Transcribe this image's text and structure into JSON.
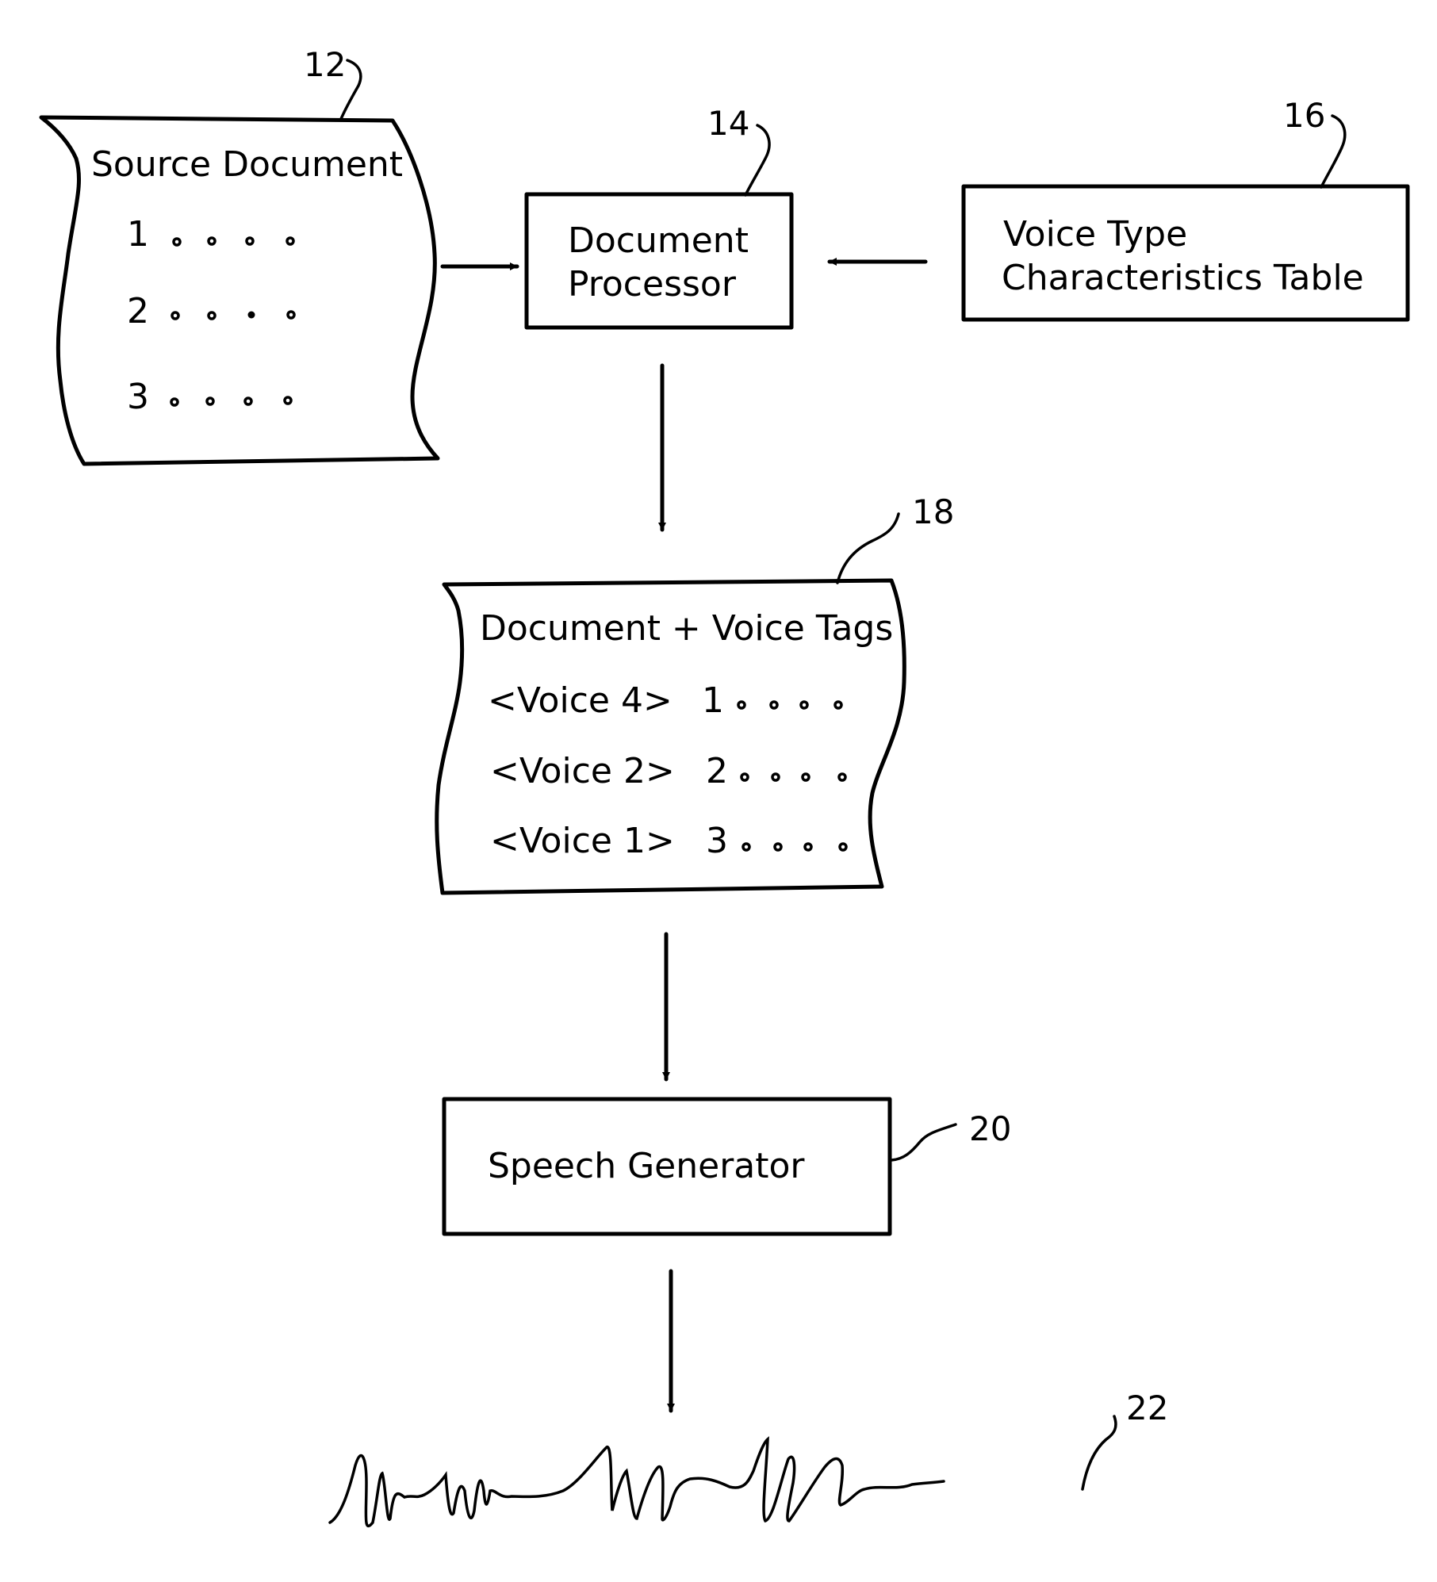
{
  "diagram": {
    "type": "flowchart",
    "nodes": {
      "source_document": {
        "ref": "12",
        "title": "Source Document",
        "lines": [
          "1",
          "2",
          "3"
        ]
      },
      "document_processor": {
        "ref": "14",
        "line1": "Document",
        "line2": "Processor"
      },
      "voice_table": {
        "ref": "16",
        "line1": "Voice Type",
        "line2": "Characteristics Table"
      },
      "tagged_document": {
        "ref": "18",
        "title": "Document + Voice Tags",
        "lines": [
          {
            "tag": "<Voice 4>",
            "item": "1"
          },
          {
            "tag": "<Voice 2>",
            "item": "2"
          },
          {
            "tag": "<Voice 1>",
            "item": "3"
          }
        ]
      },
      "speech_generator": {
        "ref": "20",
        "label": "Speech Generator"
      },
      "speech_output": {
        "ref": "22",
        "description": "speech waveform"
      }
    },
    "edges": [
      {
        "from": "source_document",
        "to": "document_processor"
      },
      {
        "from": "voice_table",
        "to": "document_processor"
      },
      {
        "from": "document_processor",
        "to": "tagged_document"
      },
      {
        "from": "tagged_document",
        "to": "speech_generator"
      },
      {
        "from": "speech_generator",
        "to": "speech_output"
      }
    ]
  }
}
